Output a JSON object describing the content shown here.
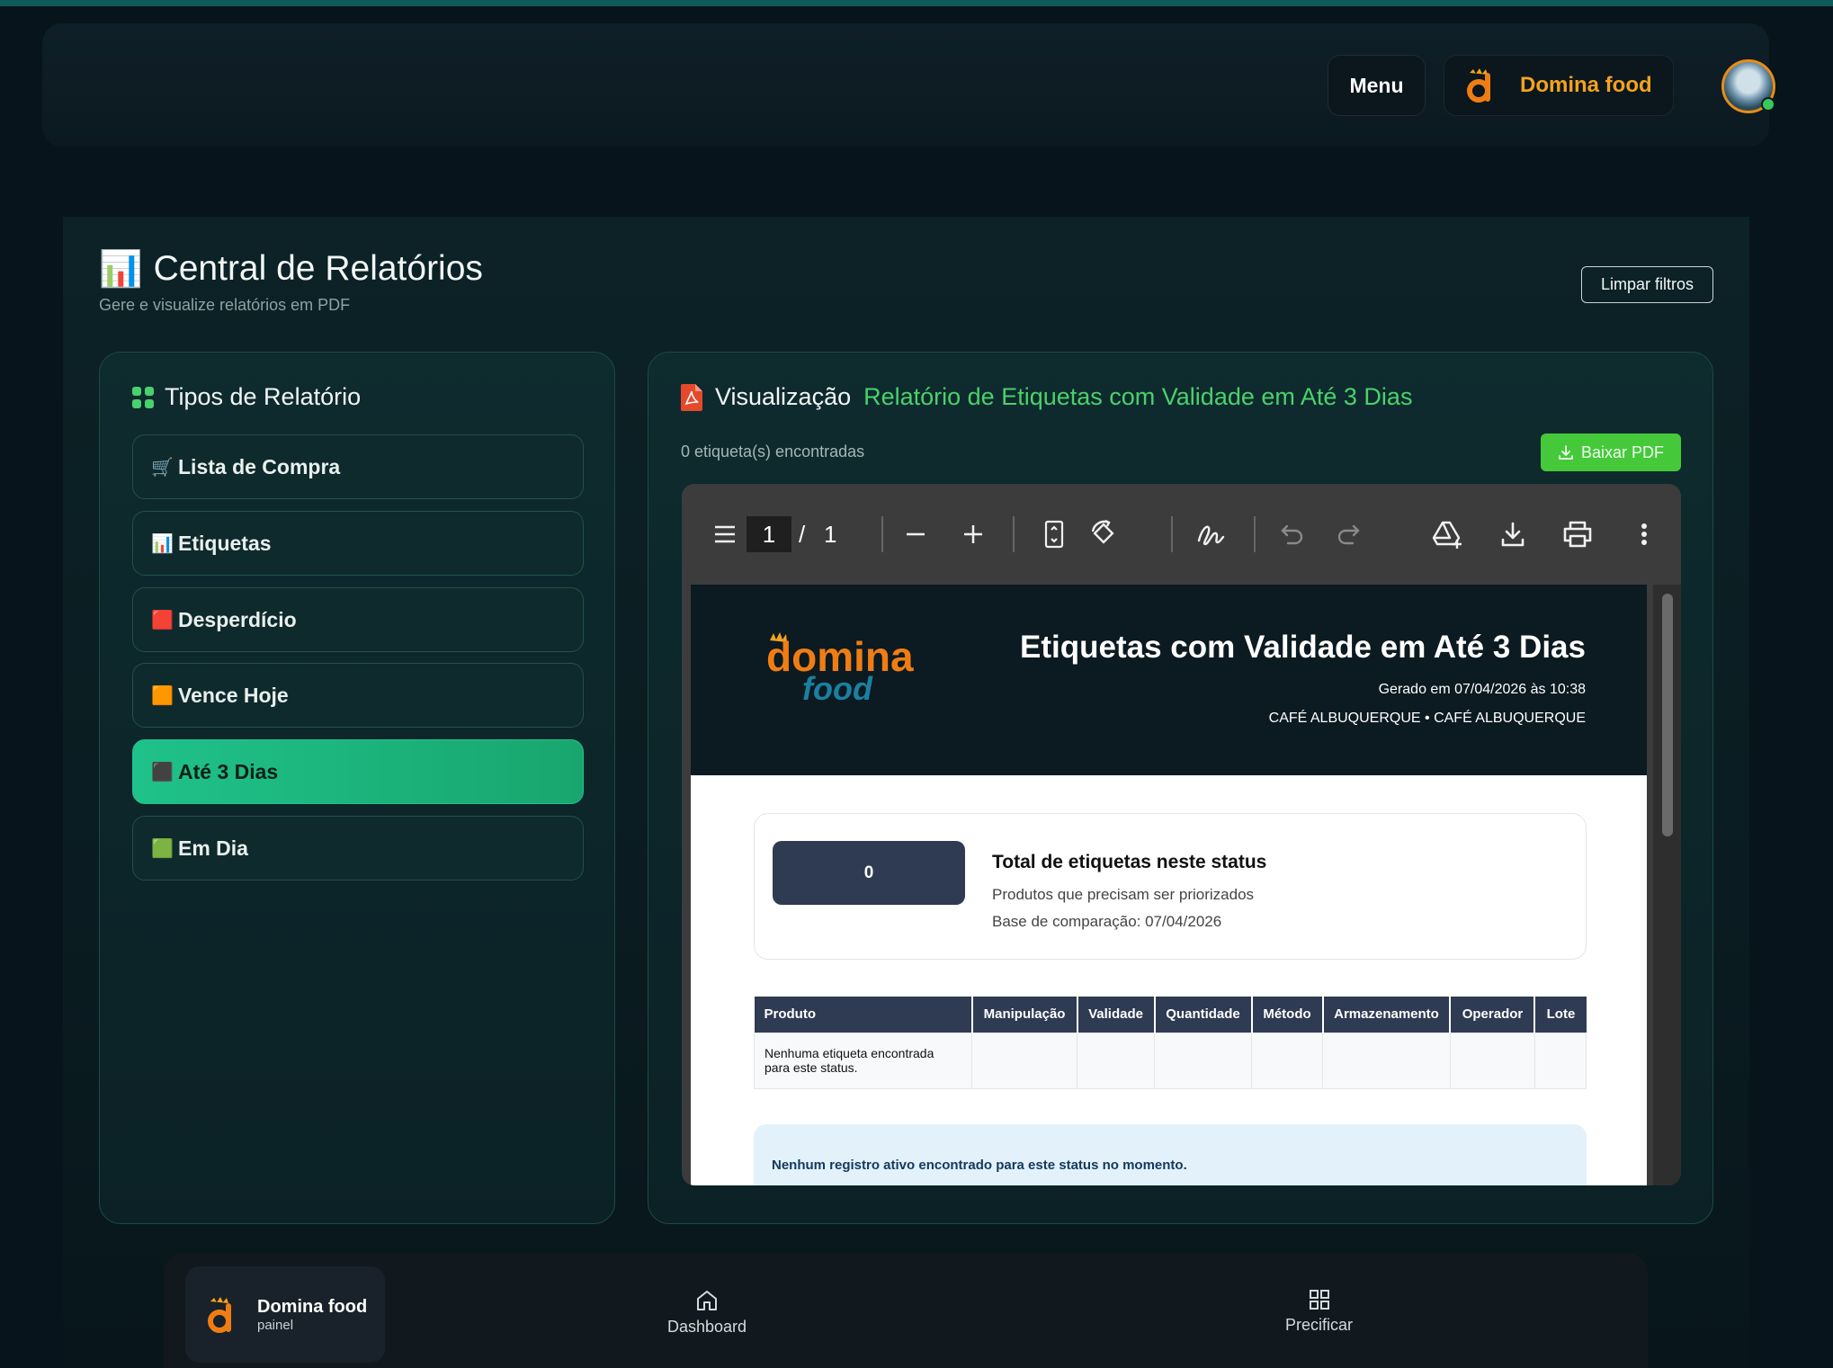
{
  "header": {
    "menu_label": "Menu",
    "brand_name": "Domina food",
    "avatar_icon": "avatar-icon",
    "brand_color": "#f4a31c"
  },
  "page": {
    "title_emoji": "📊",
    "title": "Central de Relatórios",
    "subtitle": "Gere e visualize relatórios em PDF",
    "clear_filters": "Limpar filtros"
  },
  "report_types": {
    "heading": "Tipos de Relatório",
    "items": [
      {
        "emoji": "🛒",
        "label": "Lista de Compra",
        "active": false
      },
      {
        "emoji": "📊",
        "label": "Etiquetas",
        "active": false
      },
      {
        "emoji": "🟥",
        "label": "Desperdício",
        "active": false
      },
      {
        "emoji": "🟧",
        "label": "Vence Hoje",
        "active": false
      },
      {
        "emoji": "⬛",
        "label": "Até 3 Dias",
        "active": true
      },
      {
        "emoji": "🟩",
        "label": "Em Dia",
        "active": false
      }
    ],
    "active_color": "#1fc28a"
  },
  "preview": {
    "heading": "Visualização",
    "report_title": "Relatório de Etiquetas com Validade em Até 3 Dias",
    "count_text": "0 etiqueta(s) encontradas",
    "download_label": "Baixar PDF",
    "accent_color": "#4ad16a"
  },
  "pdf_viewer": {
    "current_page": "1",
    "separator": "/",
    "total_pages": "1"
  },
  "pdf_doc": {
    "logo_top": "domina",
    "logo_bottom": "food",
    "title": "Etiquetas com Validade em Até 3 Dias",
    "generated": "Gerado em 07/04/2026 às 10:38",
    "store": "CAFÉ ALBUQUERQUE • CAFÉ ALBUQUERQUE",
    "summary": {
      "value": "0",
      "title": "Total de etiquetas neste status",
      "line1": "Produtos que precisam ser priorizados",
      "line2": "Base de comparação: 07/04/2026"
    },
    "table": {
      "headers": [
        "Produto",
        "Manipulação",
        "Validade",
        "Quantidade",
        "Método",
        "Armazenamento",
        "Operador",
        "Lote"
      ],
      "empty_row": "Nenhuma etiqueta encontrada para este status."
    },
    "notice": "Nenhum registro ativo encontrado para este status no momento."
  },
  "bottom_nav": {
    "brand_name": "Domina food",
    "brand_sub": "painel",
    "items": [
      {
        "label": "Dashboard",
        "icon": "home-icon"
      },
      {
        "label": "Precificar",
        "icon": "grid-icon"
      }
    ]
  }
}
